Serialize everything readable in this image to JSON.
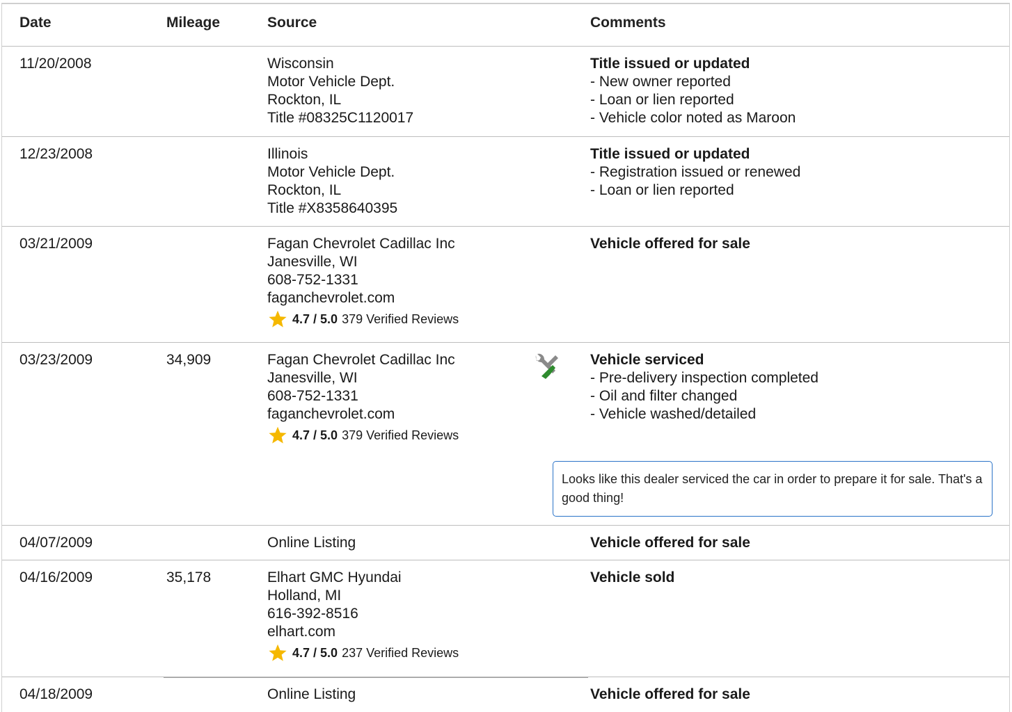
{
  "header": {
    "date": "Date",
    "mileage": "Mileage",
    "source": "Source",
    "comments": "Comments"
  },
  "rows": [
    {
      "date": "11/20/2008",
      "mileage": "",
      "source": [
        "Wisconsin",
        "Motor Vehicle Dept.",
        "Rockton, IL",
        "Title #08325C1120017"
      ],
      "comment_title": "Title issued or updated",
      "comment_items": [
        "- New owner reported",
        "- Loan or lien reported",
        "- Vehicle color noted as Maroon"
      ]
    },
    {
      "date": "12/23/2008",
      "mileage": "",
      "source": [
        "Illinois",
        "Motor Vehicle Dept.",
        "Rockton, IL",
        "Title #X8358640395"
      ],
      "comment_title": "Title issued or updated",
      "comment_items": [
        "- Registration issued or renewed",
        "- Loan or lien reported"
      ]
    },
    {
      "date": "03/21/2009",
      "mileage": "",
      "source": [
        "Fagan Chevrolet Cadillac Inc",
        "Janesville, WI",
        "608-752-1331",
        "faganchevrolet.com"
      ],
      "rating": {
        "score": "4.7 / 5.0",
        "reviews": "379 Verified Reviews"
      },
      "comment_title": "Vehicle offered for sale",
      "comment_items": []
    },
    {
      "date": "03/23/2009",
      "mileage": "34,909",
      "source": [
        "Fagan Chevrolet Cadillac Inc",
        "Janesville, WI",
        "608-752-1331",
        "faganchevrolet.com"
      ],
      "rating": {
        "score": "4.7 / 5.0",
        "reviews": "379 Verified Reviews"
      },
      "icon": "service-wrench-screwdriver-icon",
      "comment_title": "Vehicle serviced",
      "comment_items": [
        "- Pre-delivery inspection completed",
        "- Oil and filter changed",
        "- Vehicle washed/detailed"
      ],
      "callout": "Looks like this dealer serviced the car in order to prepare it for sale. That's a good thing!"
    },
    {
      "date": "04/07/2009",
      "mileage": "",
      "source": [
        "Online Listing"
      ],
      "comment_title": "Vehicle offered for sale",
      "comment_items": []
    },
    {
      "date": "04/16/2009",
      "mileage": "35,178",
      "source": [
        "Elhart GMC Hyundai",
        "Holland, MI",
        "616-392-8516",
        "elhart.com"
      ],
      "rating": {
        "score": "4.7 / 5.0",
        "reviews": "237 Verified Reviews"
      },
      "comment_title": "Vehicle sold",
      "comment_items": []
    },
    {
      "date": "04/18/2009",
      "mileage": "",
      "source": [
        "Online Listing"
      ],
      "comment_title": "Vehicle offered for sale",
      "comment_items": []
    }
  ],
  "colors": {
    "star": "#f5b800",
    "callout_border": "#2a73c8",
    "icon_gray": "#8a8a8a",
    "icon_green": "#2e8b2e"
  }
}
